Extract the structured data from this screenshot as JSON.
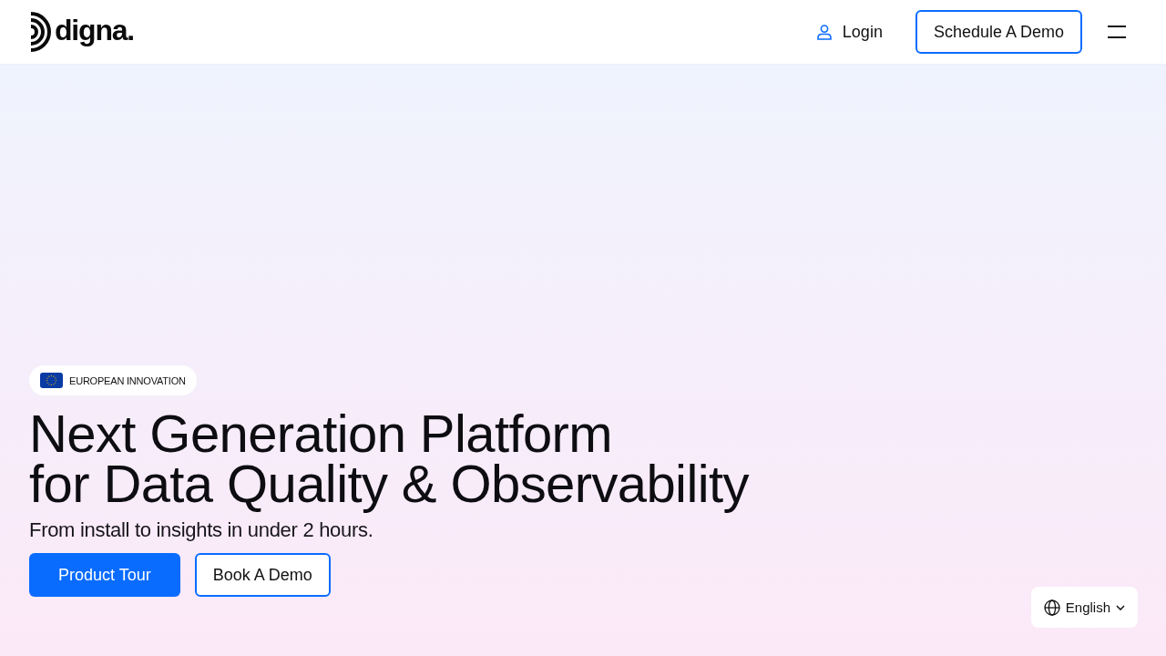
{
  "header": {
    "logo_text": "digna.",
    "login": "Login",
    "cta": "Schedule A Demo"
  },
  "hero": {
    "badge": "EUROPEAN INNOVATION",
    "title_lines": [
      "Next Generation Platform",
      "for Data Quality & Observability"
    ],
    "subtitle": "From install to insights in under 2 hours.",
    "buttons": [
      {
        "label": "Product Tour",
        "kind": "primary"
      },
      {
        "label": "Book A Demo",
        "kind": "outline"
      }
    ]
  },
  "language": {
    "label": "English"
  }
}
